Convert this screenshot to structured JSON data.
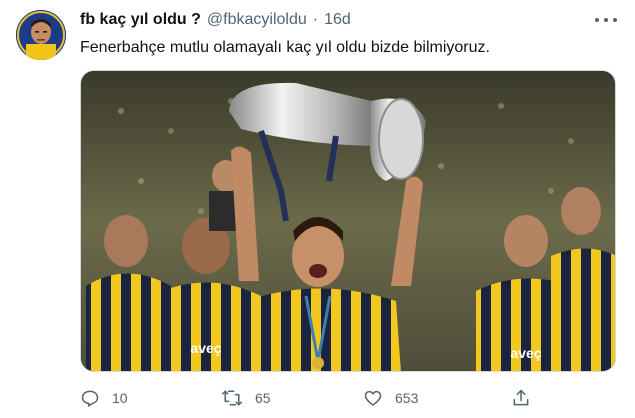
{
  "tweet": {
    "display_name": "fb kaç yıl oldu ?",
    "handle": "@fbkacyiloldu",
    "separator": "·",
    "timestamp": "16d",
    "text": "Fenerbahçe mutlu olamayalı kaç yıl oldu bizde bilmiyoruz.",
    "media": {
      "kit_logo_text": "aveç"
    }
  },
  "actions": {
    "replies": "10",
    "retweets": "65",
    "likes": "653"
  },
  "icons": {
    "more": "more-horizontal-icon",
    "reply": "reply-icon",
    "retweet": "retweet-icon",
    "like": "heart-icon",
    "share": "share-icon"
  },
  "colors": {
    "text_primary": "#0f1419",
    "text_secondary": "#536471",
    "jersey_yellow": "#f2c81e",
    "jersey_navy": "#1a2340"
  }
}
